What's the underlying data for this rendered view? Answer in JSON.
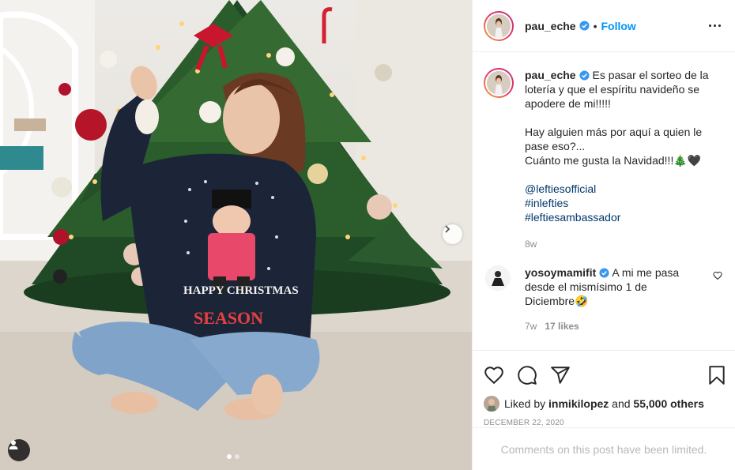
{
  "post": {
    "username": "pau_eche",
    "follow_label": "Follow",
    "separator": "•",
    "photo_subject": "Woman in Happy Christmas Season nutcracker sweater sitting in front of a Christmas tree",
    "sweater_text_line1": "HAPPY CHRISTMAS",
    "sweater_text_line2": "SEASON"
  },
  "caption": {
    "username": "pau_eche",
    "line1": "Es pasar el sorteo de la lotería y que el espíritu navideño se apodere de mi!!!!!",
    "line2": "Hay alguien más por aquí a quien le pase eso?...",
    "line3": "Cuánto me gusta la Navidad!!!🎄🖤",
    "tags": [
      "@leftiesofficial",
      "#inlefties",
      "#leftiesambassador"
    ],
    "age": "8w"
  },
  "comments": [
    {
      "username": "yosoymamifit",
      "text": "A mi me pasa desde el mismísimo 1 de Diciembre🤣",
      "age": "7w",
      "likes": "17 likes"
    }
  ],
  "likes": {
    "prefix": "Liked by",
    "user": "inmikilopez",
    "joiner": "and",
    "others": "55,000 others"
  },
  "date": "DECEMBER 22, 2020",
  "comments_limited": "Comments on this post have been limited.",
  "colors": {
    "accent": "#0095f6",
    "verified": "#3897f0",
    "text": "#262626",
    "muted": "#8e8e8e",
    "link": "#00376b"
  },
  "icons": [
    "verified-badge-icon",
    "more-options-icon",
    "heart-icon",
    "comment-icon",
    "share-icon",
    "bookmark-icon",
    "chevron-right-icon",
    "user-tag-icon"
  ]
}
